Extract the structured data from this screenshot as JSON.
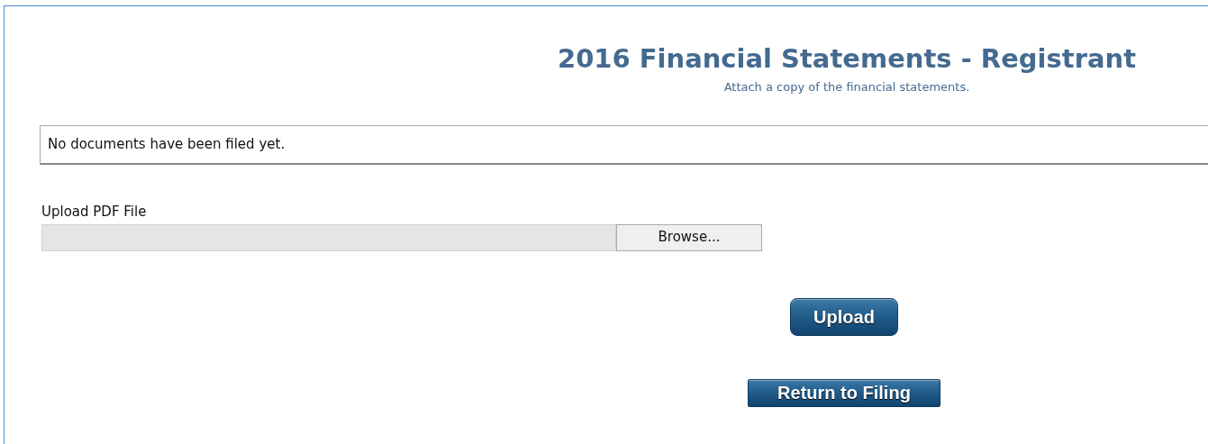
{
  "header": {
    "title": "2016 Financial Statements - Registrant",
    "subtitle": "Attach a copy of the financial statements."
  },
  "documents": {
    "message": "No documents have been filed yet."
  },
  "upload": {
    "label": "Upload PDF File",
    "browse_button": "Browse...",
    "upload_button": "Upload"
  },
  "return_button": "Return to Filing"
}
